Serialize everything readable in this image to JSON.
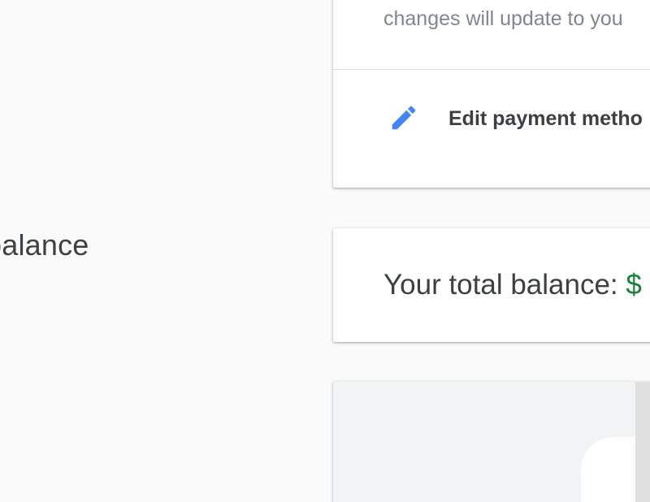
{
  "section": {
    "title": "balance"
  },
  "payment_card": {
    "description": "changes will update to you",
    "edit_label": "Edit payment metho",
    "edit_icon": "pencil-icon",
    "accent_color": "#4285f4"
  },
  "balance_card": {
    "label": "Your total balance: ",
    "amount": "$",
    "amount_color": "#188038"
  }
}
